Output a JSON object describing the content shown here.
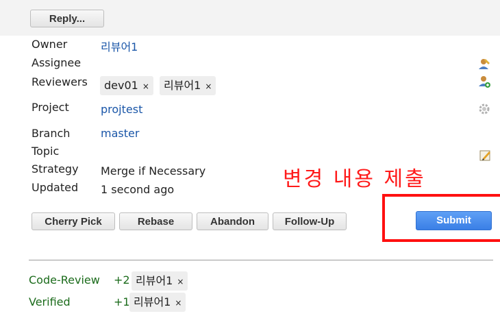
{
  "reply_button": "Reply...",
  "fields": {
    "owner_label": "Owner",
    "owner_value": "리뷰어1",
    "assignee_label": "Assignee",
    "reviewers_label": "Reviewers",
    "reviewers": [
      "dev01",
      "리뷰어1"
    ],
    "project_label": "Project",
    "project_value": "projtest",
    "branch_label": "Branch",
    "branch_value": "master",
    "topic_label": "Topic",
    "strategy_label": "Strategy",
    "strategy_value": "Merge if Necessary",
    "updated_label": "Updated",
    "updated_value": "1 second ago"
  },
  "remove_glyph": "×",
  "actions": [
    "Cherry Pick",
    "Rebase",
    "Abandon",
    "Follow-Up"
  ],
  "submit_label": "Submit",
  "annotation": "변경 내용 제출",
  "labels": {
    "code_review_label": "Code-Review",
    "code_review_score": "+2",
    "code_review_user": "리뷰어1",
    "verified_label": "Verified",
    "verified_score": "+1",
    "verified_user": "리뷰어1"
  },
  "colors": {
    "link": "#1a56a8",
    "annotation": "#ff1a1a",
    "submit": "#3a7fe6",
    "label_text": "#1b6b1b"
  },
  "icons": [
    "assign-user-icon",
    "add-reviewer-icon",
    "gear-icon",
    "edit-topic-icon"
  ]
}
